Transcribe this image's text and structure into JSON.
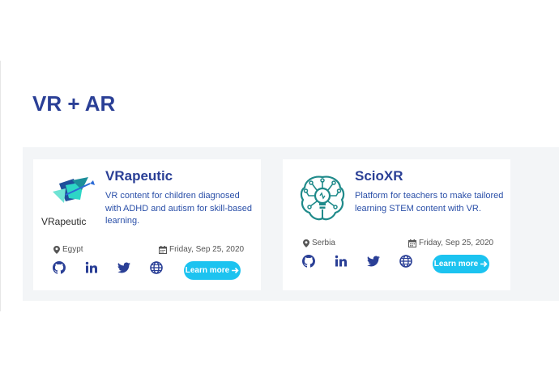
{
  "section": {
    "title": "VR + AR"
  },
  "cards": [
    {
      "name": "VRapeutic",
      "logo_text": "VRapeutic",
      "description": "VR content for children diagnosed with ADHD and autism for skill-based learning.",
      "location": "Egypt",
      "date": "Friday, Sep 25, 2020",
      "button": "Learn more"
    },
    {
      "name": "ScioXR",
      "description": "Platform for teachers to make tailored learning STEM content with VR.",
      "location": "Serbia",
      "date": "Friday, Sep 25, 2020",
      "button": "Learn more"
    }
  ],
  "colors": {
    "title": "#2a3f96",
    "accent": "#1cc3f0",
    "brain": "#1f8a8a",
    "band": "#f3f5f7"
  },
  "icons": [
    "map-marker-icon",
    "calendar-icon",
    "github-icon",
    "linkedin-icon",
    "twitter-icon",
    "globe-icon",
    "arrow-right-icon"
  ]
}
